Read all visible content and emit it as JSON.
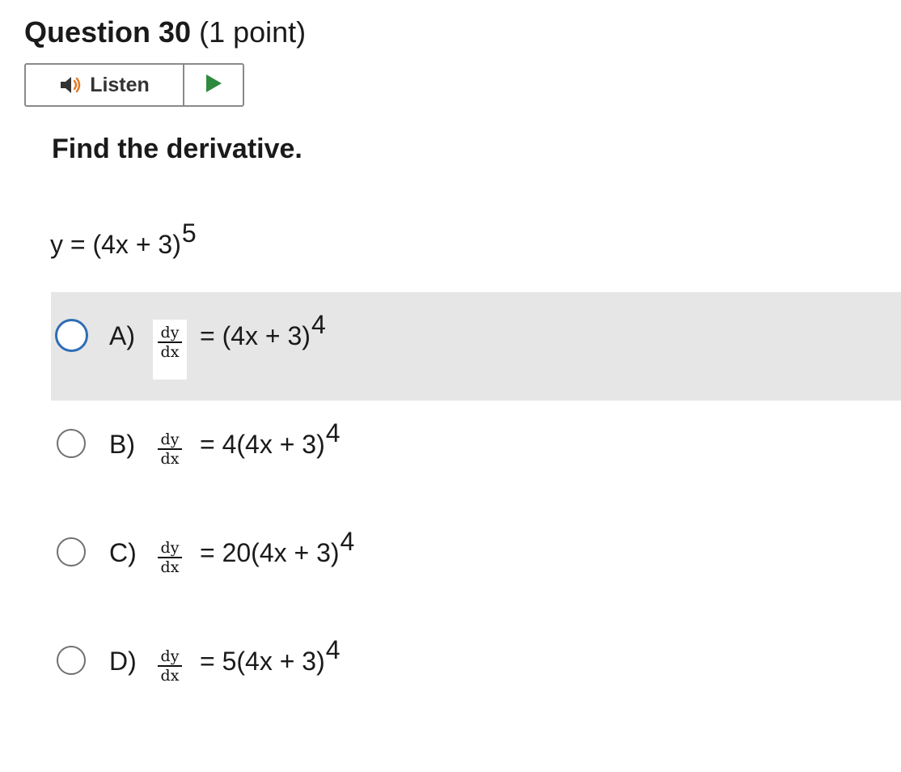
{
  "question": {
    "title": "Question 30",
    "points": "(1 point)"
  },
  "listen": {
    "label": "Listen",
    "speaker_icon": "speaker-icon",
    "play_icon": "play-icon",
    "play_color": "#2e8b3e",
    "speaker_color": "#333333",
    "sound_wave_color": "#e07b2a"
  },
  "prompt": "Find the derivative.",
  "equation": {
    "base": "y = (4x + 3)",
    "exponent": "5"
  },
  "options": [
    {
      "letter": "A)",
      "num": "dy",
      "den": "dx",
      "rhs": "= (4x + 3)",
      "exponent": "4",
      "selected": true
    },
    {
      "letter": "B)",
      "num": "dy",
      "den": "dx",
      "rhs": "= 4(4x + 3)",
      "exponent": "4",
      "selected": false
    },
    {
      "letter": "C)",
      "num": "dy",
      "den": "dx",
      "rhs": "= 20(4x + 3)",
      "exponent": "4",
      "selected": false
    },
    {
      "letter": "D)",
      "num": "dy",
      "den": "dx",
      "rhs": "= 5(4x + 3)",
      "exponent": "4",
      "selected": false
    }
  ],
  "colors": {
    "selected_row_bg": "#e6e6e6",
    "selected_radio_border": "#2f6db5",
    "radio_border": "#707070"
  }
}
